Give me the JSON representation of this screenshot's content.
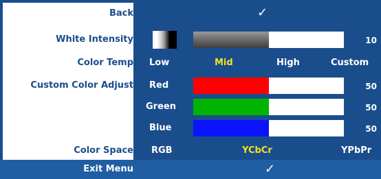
{
  "menu": {
    "back_label": "Back",
    "white_intensity": {
      "label": "White Intensity",
      "value": "10",
      "level_percent": 50
    },
    "color_temp": {
      "label": "Color Temp",
      "options": [
        "Low",
        "Mid",
        "High",
        "Custom"
      ],
      "selected": "Mid"
    },
    "custom_color_adjust": {
      "label": "Custom Color Adjust",
      "channels": [
        {
          "name": "Red",
          "value": "50",
          "level_percent": 50,
          "color": "#ff0000"
        },
        {
          "name": "Green",
          "value": "50",
          "level_percent": 50,
          "color": "#00b400"
        },
        {
          "name": "Blue",
          "value": "50",
          "level_percent": 50,
          "color": "#0a14ff"
        }
      ]
    },
    "color_space": {
      "label": "Color Space",
      "options": [
        "RGB",
        "YCbCr",
        "YPbPr"
      ],
      "selected": "YCbCr"
    },
    "exit_label": "Exit Menu",
    "check_glyph": "✓"
  },
  "colors": {
    "panel": "#1a4d8c",
    "bottom_bar": "#1f5ea3",
    "label_text": "#1a4d8c",
    "selected_option": "#f4e024",
    "intensity_fill": "gradient gray"
  }
}
